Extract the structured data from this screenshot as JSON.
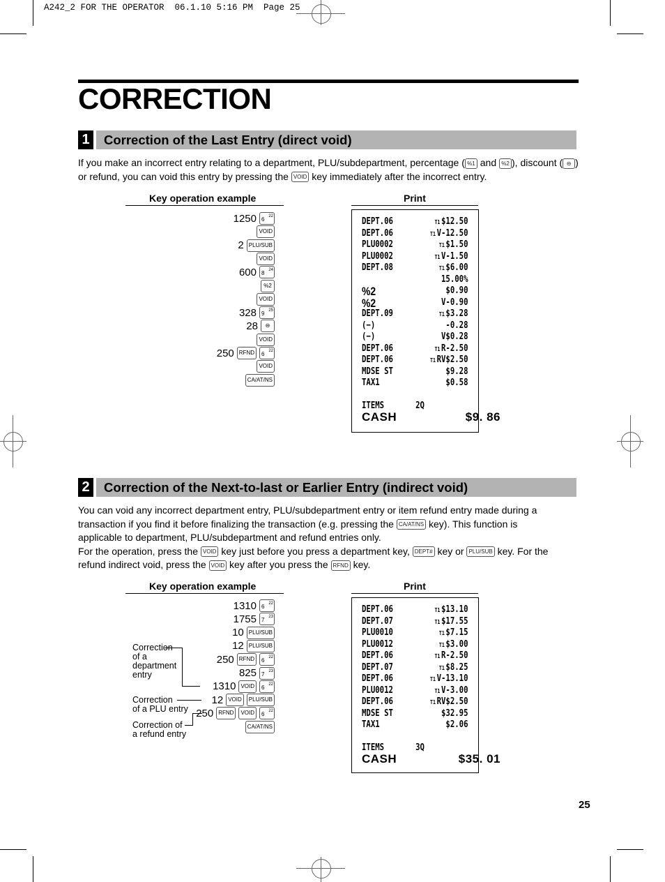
{
  "slug": "A242_2 FOR THE OPERATOR  06.1.10 5:16 PM  Page 25",
  "title": "CORRECTION",
  "page_number": "25",
  "colors": {
    "section_bar": "#b3b3b3",
    "section_number_bg": "#000000"
  },
  "section1": {
    "number": "1",
    "heading": "Correction of the Last Entry (direct void)",
    "paragraph": [
      {
        "t": "If you make an incorrect entry relating to a department, PLU/subdepartment, percentage ("
      },
      {
        "k": "%1"
      },
      {
        "t": " and "
      },
      {
        "k": "%2"
      },
      {
        "t": "), discount ("
      },
      {
        "k": "⊖"
      },
      {
        "t": ") or refund, you can void this entry by pressing the "
      },
      {
        "k": "VOID"
      },
      {
        "t": " key immediately after the incorrect entry."
      }
    ],
    "key_operation_label": "Key operation example",
    "print_label": "Print",
    "operations": [
      {
        "num": "1250",
        "keys": [
          {
            "label": "6",
            "sup": "22",
            "dept": true
          }
        ]
      },
      {
        "num": "",
        "keys": [
          {
            "label": "VOID"
          }
        ]
      },
      {
        "num": "2",
        "keys": [
          {
            "label": "PLU/SUB"
          }
        ]
      },
      {
        "num": "",
        "keys": [
          {
            "label": "VOID"
          }
        ]
      },
      {
        "num": "600",
        "keys": [
          {
            "label": "8",
            "sup": "24",
            "dept": true
          }
        ]
      },
      {
        "num": "",
        "keys": [
          {
            "label": "%2"
          }
        ]
      },
      {
        "num": "",
        "keys": [
          {
            "label": "VOID"
          }
        ]
      },
      {
        "num": "328",
        "keys": [
          {
            "label": "9",
            "sup": "25",
            "dept": true
          }
        ]
      },
      {
        "num": "28",
        "keys": [
          {
            "label": "⊖"
          }
        ]
      },
      {
        "num": "",
        "keys": [
          {
            "label": "VOID"
          }
        ]
      },
      {
        "num": "250",
        "keys": [
          {
            "label": "RFND"
          },
          {
            "label": "6",
            "sup": "22",
            "dept": true
          }
        ]
      },
      {
        "num": "",
        "keys": [
          {
            "label": "VOID"
          }
        ]
      },
      {
        "num": "",
        "keys": [
          {
            "label": "CA/AT/NS"
          }
        ]
      }
    ],
    "receipt": [
      {
        "left": "DEPT.06",
        "tax": "T1",
        "right": "$12.50"
      },
      {
        "left": "DEPT.06",
        "tax": "T1",
        "right": "V-12.50"
      },
      {
        "left": "PLU0002",
        "tax": "T1",
        "right": "$1.50"
      },
      {
        "left": "PLU0002",
        "tax": "T1",
        "right": "V-1.50"
      },
      {
        "left": "DEPT.08",
        "tax": "T1",
        "right": "$6.00"
      },
      {
        "left": "",
        "tax": "",
        "right": "15.00%"
      },
      {
        "left": "%2",
        "tax": "",
        "right": "$0.90",
        "bigleft": true
      },
      {
        "left": "%2",
        "tax": "",
        "right": "V-0.90",
        "bigleft": true
      },
      {
        "left": "DEPT.09",
        "tax": "T1",
        "right": "$3.28"
      },
      {
        "left": " (−)",
        "tax": "",
        "right": "-0.28"
      },
      {
        "left": " (−)",
        "tax": "",
        "right": "V$0.28"
      },
      {
        "left": "DEPT.06",
        "tax": "T1",
        "right": "R-2.50"
      },
      {
        "left": "DEPT.06",
        "tax": "T1",
        "right": "RV$2.50"
      },
      {
        "left": "MDSE ST",
        "tax": "",
        "right": "$9.28"
      },
      {
        "left": "TAX1",
        "tax": "",
        "right": "$0.58"
      }
    ],
    "items_label": "ITEMS",
    "items_value": "2Q",
    "cash_label": "CASH",
    "cash_value": "$9. 86"
  },
  "section2": {
    "number": "2",
    "heading": "Correction of the Next-to-last or Earlier Entry (indirect void)",
    "paragraph_lines": [
      [
        {
          "t": "You can void any incorrect department entry, PLU/subdepartment entry or item refund entry made during a"
        }
      ],
      [
        {
          "t": "transaction if you find it before finalizing the transaction (e.g. pressing the "
        },
        {
          "k": "CA/AT/NS"
        },
        {
          "t": " key).  This function is"
        }
      ],
      [
        {
          "t": "applicable to department, PLU/subdepartment and refund entries only."
        }
      ],
      [
        {
          "t": "For the operation, press the "
        },
        {
          "k": "VOID"
        },
        {
          "t": " key just before you press a department key, "
        },
        {
          "k": "DEPT#"
        },
        {
          "t": " key or "
        },
        {
          "k": "PLU/SUB"
        },
        {
          "t": " key. For the"
        }
      ],
      [
        {
          "t": "refund indirect void, press the "
        },
        {
          "k": "VOID"
        },
        {
          "t": " key after you press the "
        },
        {
          "k": "RFND"
        },
        {
          "t": " key."
        }
      ]
    ],
    "key_operation_label": "Key operation example",
    "print_label": "Print",
    "operations": [
      {
        "num": "1310",
        "keys": [
          {
            "label": "6",
            "sup": "22",
            "dept": true
          }
        ]
      },
      {
        "num": "1755",
        "keys": [
          {
            "label": "7",
            "sup": "23",
            "dept": true
          }
        ]
      },
      {
        "num": "10",
        "keys": [
          {
            "label": "PLU/SUB"
          }
        ]
      },
      {
        "num": "12",
        "keys": [
          {
            "label": "PLU/SUB"
          }
        ]
      },
      {
        "num": "250",
        "keys": [
          {
            "label": "RFND"
          },
          {
            "label": "6",
            "sup": "22",
            "dept": true
          }
        ]
      },
      {
        "num": "825",
        "keys": [
          {
            "label": "7",
            "sup": "23",
            "dept": true
          }
        ]
      },
      {
        "num": "1310",
        "keys": [
          {
            "label": "VOID"
          },
          {
            "label": "6",
            "sup": "22",
            "dept": true
          }
        ]
      },
      {
        "num": "12",
        "keys": [
          {
            "label": "VOID"
          },
          {
            "label": "PLU/SUB"
          }
        ]
      },
      {
        "num": "250",
        "keys": [
          {
            "label": "RFND"
          },
          {
            "label": "VOID"
          },
          {
            "label": "6",
            "sup": "22",
            "dept": true
          }
        ]
      },
      {
        "num": "",
        "keys": [
          {
            "label": "CA/AT/NS"
          }
        ]
      }
    ],
    "annotations": {
      "department": "Correction\nof a\ndepartment\nentry",
      "plu": "Correction\nof a PLU entry",
      "refund": "Correction of\na refund entry"
    },
    "receipt": [
      {
        "left": "DEPT.06",
        "tax": "T1",
        "right": "$13.10"
      },
      {
        "left": "DEPT.07",
        "tax": "T1",
        "right": "$17.55"
      },
      {
        "left": "PLU0010",
        "tax": "T1",
        "right": "$7.15"
      },
      {
        "left": "PLU0012",
        "tax": "T1",
        "right": "$3.00"
      },
      {
        "left": "DEPT.06",
        "tax": "T1",
        "right": "R-2.50"
      },
      {
        "left": "DEPT.07",
        "tax": "T1",
        "right": "$8.25"
      },
      {
        "left": "DEPT.06",
        "tax": "T1",
        "right": "V-13.10"
      },
      {
        "left": "PLU0012",
        "tax": "T1",
        "right": "V-3.00"
      },
      {
        "left": "DEPT.06",
        "tax": "T1",
        "right": "RV$2.50"
      },
      {
        "left": "MDSE ST",
        "tax": "",
        "right": "$32.95"
      },
      {
        "left": "TAX1",
        "tax": "",
        "right": "$2.06"
      }
    ],
    "items_label": "ITEMS",
    "items_value": "3Q",
    "cash_label": "CASH",
    "cash_value": "$35. 01"
  }
}
